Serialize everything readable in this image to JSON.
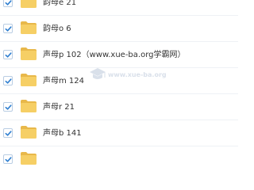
{
  "colors": {
    "checkbox_check": "#2f7fd1",
    "checkbox_border": "#b9cde3",
    "folder_back": "#e8b84a",
    "folder_front": "#f6cf65",
    "text": "#333333",
    "watermark": "#8fa3c0"
  },
  "icons": {
    "checkbox": "checkmark-icon",
    "item": "folder-icon",
    "watermark": "graduation-cap-logo"
  },
  "file_list": {
    "items": [
      {
        "label": "韵母e 21",
        "checked": true
      },
      {
        "label": "韵母o 6",
        "checked": true
      },
      {
        "label": "声母p 102（www.xue-ba.org学霸网）",
        "checked": true
      },
      {
        "label": "声母m 124",
        "checked": true
      },
      {
        "label": "声母r 21",
        "checked": true
      },
      {
        "label": "声母b 141",
        "checked": true
      },
      {
        "label": "",
        "checked": true
      }
    ]
  },
  "watermark": {
    "text": "www.xue-ba.org"
  }
}
